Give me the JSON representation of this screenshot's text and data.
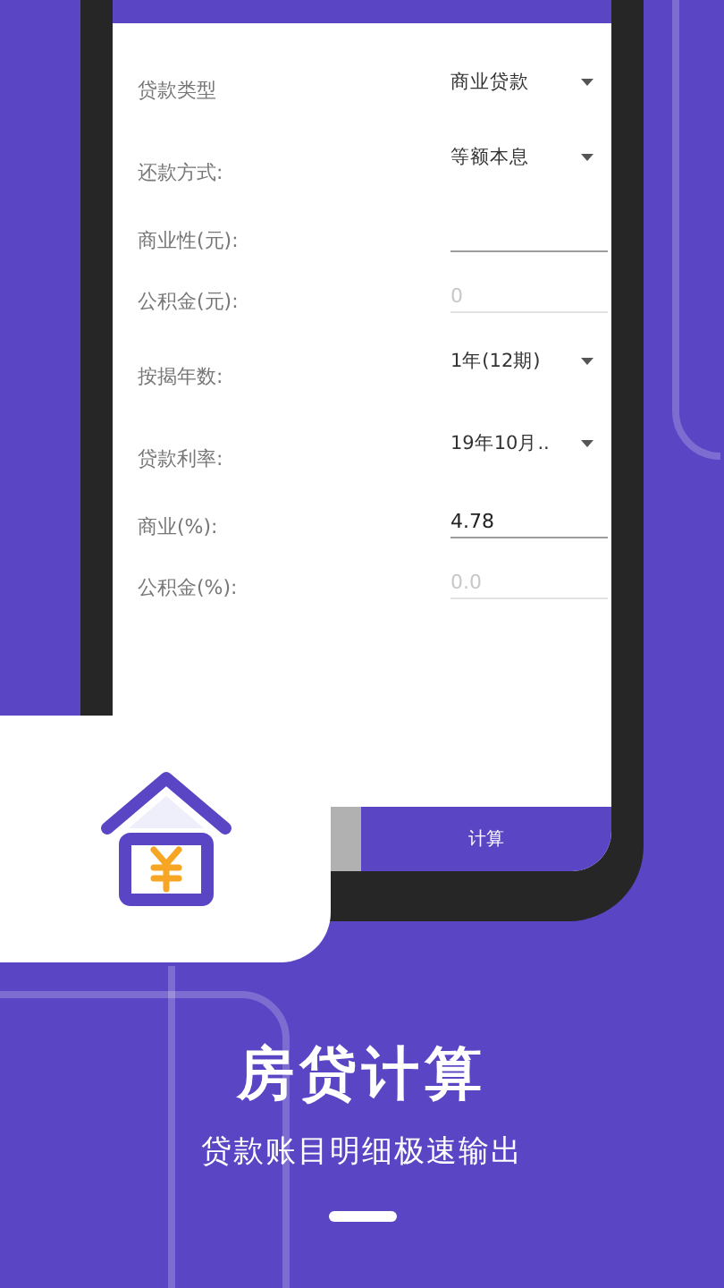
{
  "form": {
    "fields": [
      {
        "kind": "dropdown",
        "label": "贷款类型",
        "value": "商业贷款"
      },
      {
        "kind": "dropdown",
        "label": "还款方式:",
        "value": "等额本息"
      },
      {
        "kind": "input",
        "label": "商业性(元):",
        "disabled": false
      },
      {
        "kind": "input",
        "label": "公积金(元):",
        "placeholder": "0",
        "disabled": true
      },
      {
        "kind": "dropdown",
        "label": "按揭年数:",
        "value": "1年(12期)"
      },
      {
        "kind": "dropdown",
        "label": "贷款利率:",
        "value": "19年10月.."
      },
      {
        "kind": "input",
        "label": "商业(%):",
        "value": "4.78",
        "disabled": false
      },
      {
        "kind": "input",
        "label": "公积金(%):",
        "placeholder": "0.0",
        "disabled": true
      }
    ]
  },
  "bottom_bar": {
    "primary_button": "计算"
  },
  "promo": {
    "title": "房贷计算",
    "subtitle": "贷款账目明细极速输出"
  }
}
